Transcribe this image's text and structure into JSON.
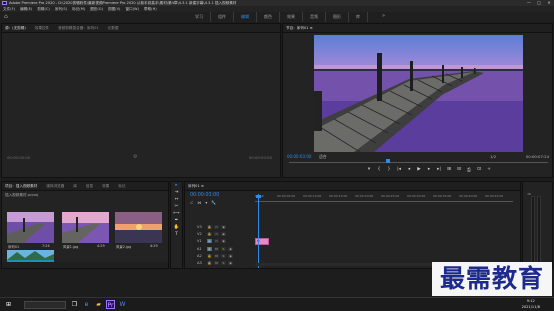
{
  "titlebar": {
    "title": "Adobe Premiere Pro 2020 - D:\\2020剪辑软件\\最新视频Premiere Pro 2020 从新手到高手\\素材\\第4章\\4.3.1 新建字幕\\4.3.1 插入视频素材",
    "minimize": "—",
    "maximize": "□",
    "close": "✕"
  },
  "menu": [
    "文件(F)",
    "编辑(E)",
    "剪辑(C)",
    "序列(S)",
    "标记(M)",
    "图形(G)",
    "视图(V)",
    "窗口(W)",
    "帮助(H)"
  ],
  "workspace": {
    "home_icon": "home-icon",
    "tabs": [
      "学习",
      "组件",
      "编辑",
      "颜色",
      "效果",
      "音频",
      "图形",
      "库"
    ],
    "active": "编辑",
    "more": "»"
  },
  "source_panel": {
    "tabs": [
      "源：(无剪辑)",
      "效果控件",
      "音频剪辑混合器：序列01",
      "元数据"
    ],
    "timecode_left": "00:00:00:00",
    "timecode_right": "00:00:00:00"
  },
  "program_panel": {
    "tab": "节目：序列01 ≡",
    "timecode": "00:00:03:00",
    "fit": "适合",
    "resolution": "1/2",
    "duration": "00:00:07:24",
    "progress": 0.38,
    "controls": [
      "▾",
      "{",
      "}",
      "|◂",
      "◂",
      "▶",
      "▸",
      "▸|",
      "⊞",
      "⊟",
      "⎙",
      "⊡",
      "+"
    ]
  },
  "project_panel": {
    "tabs": [
      "项目：插入视频素材",
      "媒体浏览器",
      "库",
      "信息",
      "效果",
      "标记"
    ],
    "path": "插入视频素材.prproj",
    "items": [
      {
        "name": "序列01",
        "duration": "7:24"
      },
      {
        "name": "风景1.jpg",
        "duration": "4:29"
      },
      {
        "name": "风景2.jpg",
        "duration": "4:29"
      },
      {
        "name": "风景3.jpg",
        "duration": ""
      }
    ]
  },
  "tools": [
    "▸",
    "⇥",
    "↔",
    "✂",
    "⟷",
    "✒",
    "✋",
    "T"
  ],
  "timeline": {
    "tab": "序列01 ≡",
    "timecode": "00:00:03:00",
    "ruler_labels": [
      "00:00",
      "00:00:05:00",
      "00:00:10:00",
      "00:00:15:00",
      "00:00:20:00",
      "00:00:25:00",
      "00:00:30:00",
      "00:00:35:00",
      "00:00:40:00",
      "00:00:45:00"
    ],
    "video_tracks": [
      "V3",
      "V2",
      "V1"
    ],
    "audio_tracks": [
      "A1",
      "A2",
      "A3"
    ],
    "buttons": [
      "M",
      "S",
      "◉"
    ],
    "clip_label": "fx",
    "mix_label": "主声道",
    "mix_value": "0.0"
  },
  "meters": {
    "label": "dB"
  },
  "watermark": "最需教育",
  "taskbar": {
    "icons": [
      "windows-icon",
      "search-icon",
      "task-view-icon",
      "edge-icon",
      "explorer-icon",
      "premiere-icon",
      "word-icon"
    ],
    "time": "9:12",
    "date": "2021/11/8"
  }
}
